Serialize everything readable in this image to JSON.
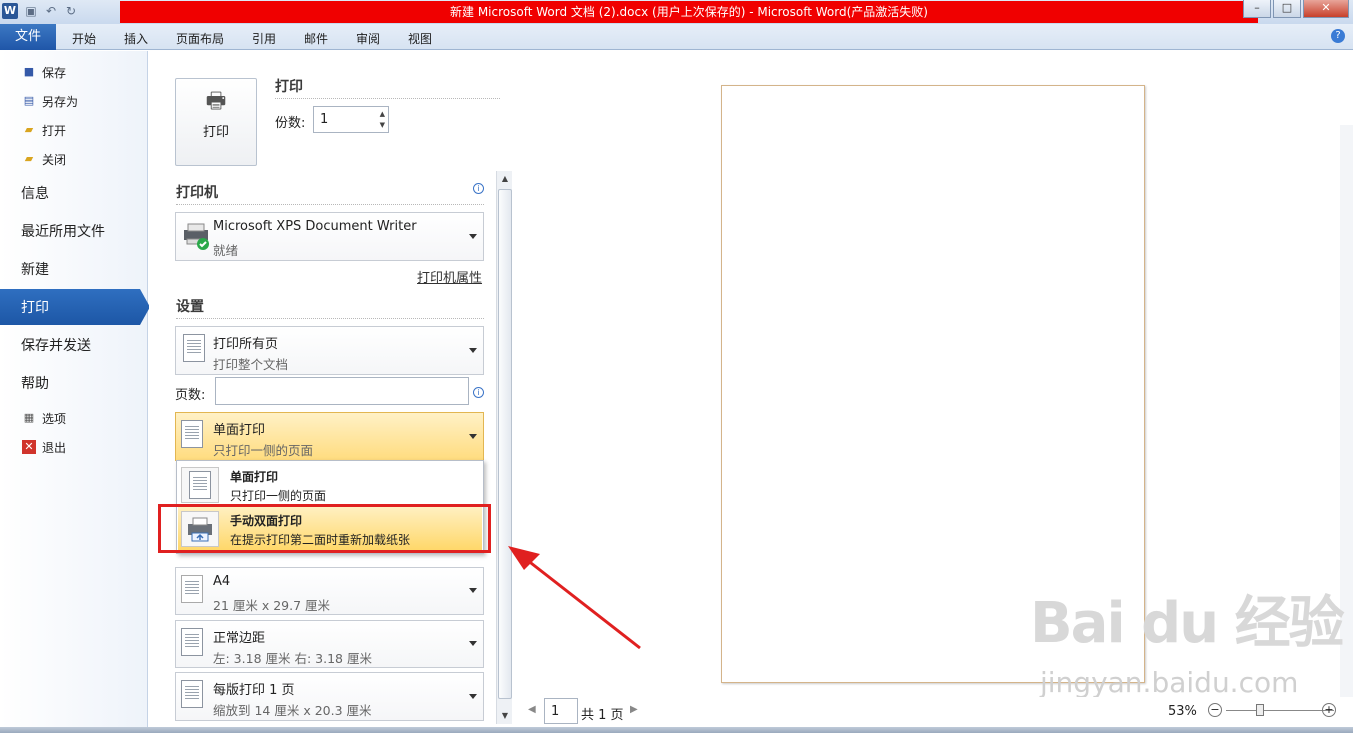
{
  "window": {
    "title": "新建 Microsoft Word 文档 (2).docx (用户上次保存的)  -  Microsoft Word(产品激活失败)",
    "logo": "W",
    "controls": [
      "–",
      "□",
      "✕"
    ]
  },
  "ribbon": {
    "file_tab": "文件",
    "tabs": [
      "开始",
      "插入",
      "页面布局",
      "引用",
      "邮件",
      "审阅",
      "视图"
    ]
  },
  "nav": {
    "small_top": [
      "保存",
      "另存为",
      "打开",
      "关闭"
    ],
    "big": [
      "信息",
      "最近所用文件",
      "新建",
      "打印",
      "保存并发送",
      "帮助"
    ],
    "small_bottom": [
      "选项",
      "退出"
    ],
    "selected": "打印"
  },
  "print": {
    "section_title": "打印",
    "button_label": "打印",
    "copies_label": "份数:",
    "copies_value": "1"
  },
  "printer": {
    "section_title": "打印机",
    "name": "Microsoft XPS Document Writer",
    "status": "就绪",
    "properties_link": "打印机属性"
  },
  "settings": {
    "section_title": "设置",
    "range_title": "打印所有页",
    "range_sub": "打印整个文档",
    "pages_label": "页数:",
    "pages_value": "",
    "sides_title": "单面打印",
    "sides_sub": "只打印一侧的页面",
    "paper_title": "A4",
    "paper_sub": "21 厘米 x 29.7 厘米",
    "margins_title": "正常边距",
    "margins_sub": "左:  3.18 厘米    右:  3.18 厘米",
    "persheet_title": "每版打印 1 页",
    "persheet_sub": "缩放到 14 厘米 x 20.3 厘米"
  },
  "popup": {
    "options": [
      {
        "title": "单面打印",
        "sub": "只打印一侧的页面"
      },
      {
        "title": "手动双面打印",
        "sub": "在提示打印第二面时重新加载纸张"
      }
    ]
  },
  "preview": {
    "page_input": "1",
    "page_total": "共 1 页",
    "zoom": "53%"
  },
  "watermark": {
    "brand": "Bai du 经验",
    "url": "jingyan.baidu.com"
  },
  "colors": {
    "title_bar_red": "#f00000",
    "accent_blue": "#1d57a6",
    "highlight_yellow": "#ffd768",
    "annotation_red": "#e02020"
  }
}
